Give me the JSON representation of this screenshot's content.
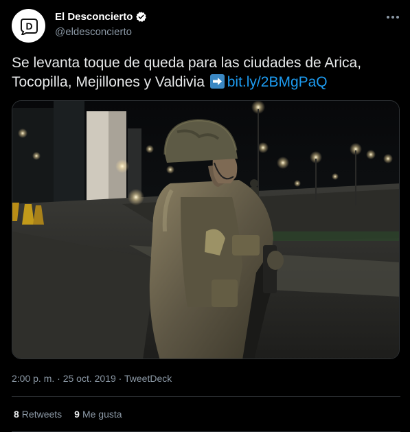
{
  "author": {
    "display_name": "El Desconcierto",
    "handle": "@eldesconcierto",
    "avatar_letter": "D",
    "verified": true
  },
  "tweet": {
    "text": "Se levanta toque de queda para las ciudades de Arica, Tocopilla, Mejillones y Valdivia",
    "emoji": "arrow-right-icon",
    "link": "bit.ly/2BMgPaQ"
  },
  "media": {
    "type": "photo"
  },
  "meta": {
    "time": "2:00 p. m.",
    "separator": "·",
    "date": "25 oct. 2019",
    "source": "TweetDeck"
  },
  "stats": {
    "retweets_count": "8",
    "retweets_label": "Retweets",
    "likes_count": "9",
    "likes_label": "Me gusta"
  },
  "colors": {
    "background": "#000000",
    "link": "#1d9bf0",
    "secondary_text": "#8b98a5",
    "primary_text": "#e7e9ea",
    "divider": "#2f3336"
  }
}
